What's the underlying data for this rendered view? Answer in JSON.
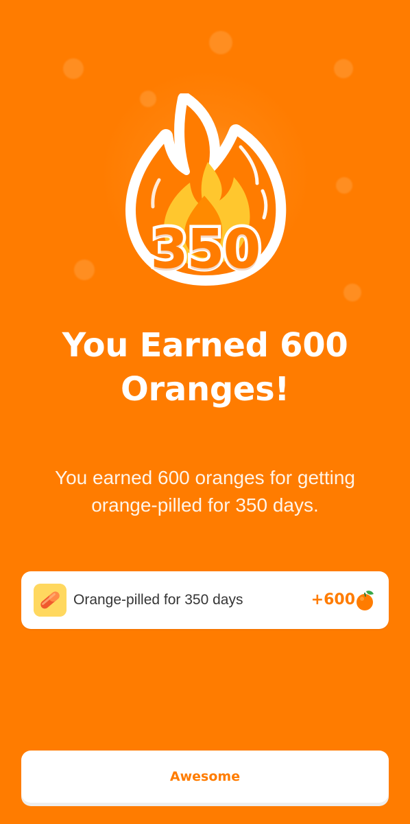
{
  "app": {
    "name": "Orange streak reward"
  },
  "colors": {
    "background": "#ff7c00",
    "accent": "#ff7c00",
    "card": "#ffffff",
    "flame_outer": "#ff7c00",
    "flame_middle": "#ffc72e",
    "flame_inner": "#ff8a00",
    "reward_icon_background": "#ffd85f"
  },
  "streak": {
    "icon": "flame-icon",
    "count": "350"
  },
  "headline": {
    "title": "You Earned 600 Oranges!",
    "subtitle": "You earned 600 oranges for getting orange-pilled for 350 days."
  },
  "reward": {
    "icon": "pill-icon",
    "label": "Orange-pilled for 350 days",
    "amount": "+600",
    "currency_icon": "orange-icon"
  },
  "actions": {
    "awesome_label": "Awesome"
  }
}
